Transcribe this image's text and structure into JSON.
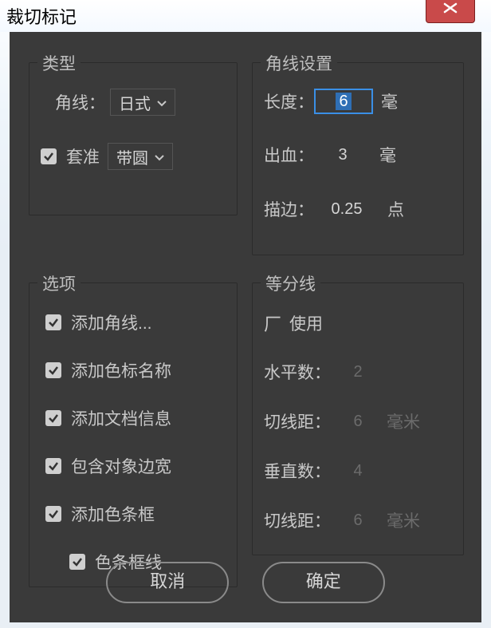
{
  "window": {
    "title": "裁切标记"
  },
  "type_group": {
    "title": "类型",
    "corner_label": "角线：",
    "corner_value": "日式",
    "register_label": "套准",
    "register_value": "带圆"
  },
  "corner_group": {
    "title": "角线设置",
    "length_label": "长度：",
    "length_value": "6",
    "length_unit": "毫",
    "bleed_label": "出血：",
    "bleed_value": "3",
    "bleed_unit": "毫",
    "stroke_label": "描边：",
    "stroke_value": "0.25",
    "stroke_unit": "点"
  },
  "options_group": {
    "title": "选项",
    "items": [
      "添加角线...",
      "添加色标名称",
      "添加文档信息",
      "包含对象边宽",
      "添加色条框",
      "色条框线"
    ]
  },
  "divide_group": {
    "title": "等分线",
    "use_label": "使用",
    "h_count_label": "水平数：",
    "h_count_value": "2",
    "h_cut_label": "切线距：",
    "h_cut_value": "6",
    "h_cut_unit": "毫米",
    "v_count_label": "垂直数：",
    "v_count_value": "4",
    "v_cut_label": "切线距：",
    "v_cut_value": "6",
    "v_cut_unit": "毫米"
  },
  "buttons": {
    "cancel": "取消",
    "ok": "确定"
  }
}
